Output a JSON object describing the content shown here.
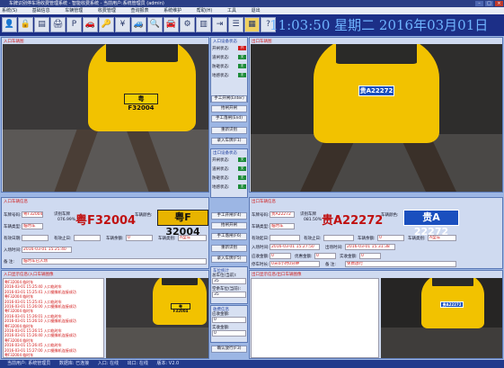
{
  "window": {
    "title": "车牌识别停车场收费管理系统 - 智能收费系统 - 当前用户:系统管理员 (admin)",
    "min_glyph": "–",
    "max_glyph": "□",
    "close_glyph": "×"
  },
  "menu": [
    "系统(S)",
    "基础信息",
    "车辆管理",
    "收费管理",
    "查询报表",
    "系统维护",
    "帮助(H)",
    "工具",
    "退出"
  ],
  "toolbar": {
    "tools": [
      "user-icon",
      "lock-icon",
      "card-icon",
      "printer-icon",
      "letter-p-icon",
      "car-icon",
      "key-icon",
      "cash-icon",
      "car2-icon",
      "search-icon",
      "car3-icon",
      "gear-icon",
      "chart-icon",
      "exit-icon",
      "settings-icon",
      "grid-icon",
      "help-icon"
    ],
    "glyphs": [
      "👤",
      "🔒",
      "▤",
      "🖨",
      "P",
      "🚗",
      "🔑",
      "¥",
      "🚙",
      "🔍",
      "🚘",
      "⚙",
      "▥",
      "⇥",
      "☰",
      "▦",
      "?"
    ],
    "clock": "11:03:50 星期二 2016年03月01日"
  },
  "entry": {
    "camera_title": "入口车辆图",
    "plate_on_car": "粤F32004",
    "panel_title": "入口车辆信息",
    "labels": {
      "plate": "车牌号码:",
      "type": "车辆类型:",
      "valid_from": "有效日期:",
      "valid_to": "有效止日:",
      "balance": "车辆余额:",
      "category": "车辆类别:",
      "in_time": "入场时间:",
      "remark": "备    注:",
      "recog_plate": "识别车牌",
      "plate_color": "车辆颜色:"
    },
    "values": {
      "plate": "粤F32004",
      "type": "临时车",
      "recog_plate": "粤F32004",
      "confidence": "076.99%",
      "in_time": "2016-03-01 15:25:40",
      "remark": "临时车已入场",
      "balance": "0",
      "category": "A型车"
    },
    "big_plate_text": "粤F32004",
    "plate_image_text": "粤F 32004",
    "log_title": "入口显示信息/入口车辆图像",
    "log_lines": [
      "粤F32004 临时车",
      "2016-03-01 15:25:40 入口临时车",
      "2016-03-01 15:25:41 入口摄像机连接成功",
      "粤F32004 临时车",
      "2016-03-01 15:25:41 入口临时车",
      "2016-03-01 15:26:00 入口摄像机连接成功",
      "粤F32004 临时车",
      "2016-03-01 15:26:01 入口临时车",
      "2016-03-01 15:26:10 入口摄像机连接成功",
      "粤F32004 临时车",
      "2016-03-01 15:26:15 入口临时车",
      "2016-03-01 15:26:40 入口摄像机连接成功",
      "粤F32004 临时车",
      "2016-03-01 15:26:45 入口临时车",
      "2016-03-01 15:27:00 入口摄像机连接成功",
      "粤F32004 临时车"
    ],
    "plate_on_car_small": "粤F32004"
  },
  "middle": {
    "status_title": "入口设备状态",
    "status_rows": [
      {
        "label": "开闸状态:",
        "value": "开"
      },
      {
        "label": "道闸状态:",
        "value": "关"
      },
      {
        "label": "防砸状态:",
        "value": "无"
      },
      {
        "label": "地感状态:",
        "value": "无"
      }
    ],
    "entry_buttons": [
      "手工开闸(Enter)",
      "抬闸开闸",
      "手工落闸(End)",
      "重新识别",
      "录入车牌(F1)"
    ],
    "exit_status_title": "出口设备状态",
    "exit_status_rows": [
      {
        "label": "开闸状态:",
        "value": "关"
      },
      {
        "label": "道闸状态:",
        "value": "关"
      },
      {
        "label": "防砸状态:",
        "value": "无"
      },
      {
        "label": "地感状态:",
        "value": "无"
      }
    ],
    "exit_buttons": [
      "手工开闸(F4)",
      "抬闸开闸",
      "手工落闸(F6)",
      "重新识别",
      "录入车牌(F5)"
    ],
    "stats_title": "车位统计",
    "stats": [
      {
        "label": "总车位(当前):",
        "value": "35"
      },
      {
        "label": "空余车位(当前):",
        "value": "35"
      }
    ],
    "fee_title": "收费信息",
    "fee": [
      {
        "label": "应收金额:",
        "value": "0"
      },
      {
        "label": "实收金额:",
        "value": "0"
      }
    ],
    "confirm_button": "确认放行(F3)"
  },
  "exit": {
    "camera_title": "出口车辆图",
    "plate_on_car": "贵A22272",
    "panel_title": "出口车辆信息",
    "labels": {
      "plate": "车牌号码:",
      "type": "车辆类型:",
      "valid_from": "有效起日:",
      "valid_to": "有效止日:",
      "balance": "车辆余额:",
      "category": "车辆类别:",
      "in_time": "入场时间:",
      "out_time": "出场时间:",
      "should": "应收金额:",
      "paid": "实收金额:",
      "free": "优惠金额:",
      "duration": "停车时长:",
      "remark": "备    注:",
      "recog_plate": "识别车牌",
      "plate_color": "车辆颜色:"
    },
    "values": {
      "plate": "贵A22272",
      "type": "临时车",
      "recog_plate": "贵A22272",
      "confidence": "081.50%",
      "in_time": "2016-03-01 15:27:50",
      "out_time": "2016-03-01 15:31:38",
      "duration": "0天0小时0分钟",
      "should": "0",
      "paid": "0",
      "free": "0",
      "balance": "0",
      "category": "A型车",
      "remark": "免费放行"
    },
    "big_plate_text": "贵A22272",
    "plate_image_text": "贵A 22272",
    "log_title": "出口显示信息/出口车辆图像"
  },
  "status": {
    "items": [
      "当前用户: 系统管理员",
      "数据库: 已连接",
      "入口: 在线",
      "出口: 在线",
      "版本: V2.0"
    ]
  }
}
